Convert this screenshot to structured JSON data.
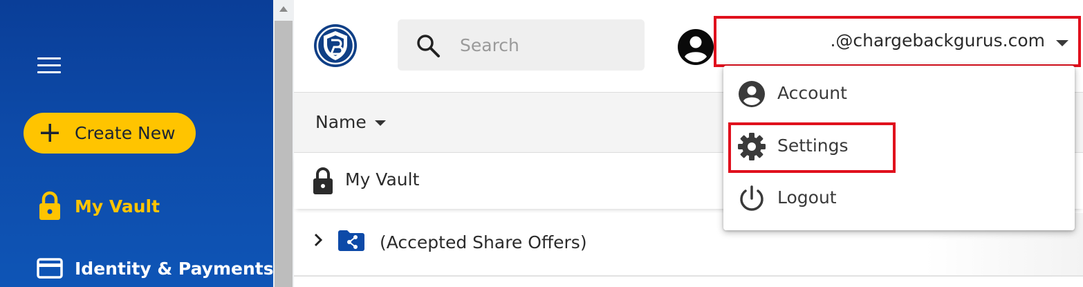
{
  "sidebar": {
    "menu_icon": "hamburger-icon",
    "create_button": {
      "label": "Create New",
      "icon": "plus-icon"
    },
    "items": [
      {
        "label": "My Vault",
        "icon": "lock-icon",
        "active": true
      },
      {
        "label": "Identity & Payments",
        "icon": "credit-card-icon",
        "active": false
      }
    ]
  },
  "header": {
    "logo_icon": "keeper-shield-logo",
    "search": {
      "placeholder": "Search",
      "value": ""
    },
    "user": {
      "email": ".@chargebackgurus.com",
      "avatar_icon": "account-circle-icon"
    }
  },
  "user_menu": {
    "items": [
      {
        "label": "Account",
        "icon": "account-circle-icon"
      },
      {
        "label": "Settings",
        "icon": "gear-icon"
      },
      {
        "label": "Logout",
        "icon": "power-icon"
      }
    ]
  },
  "table": {
    "sort_column": "Name",
    "rows": [
      {
        "label": "My Vault",
        "icon": "lock-icon"
      },
      {
        "label": "(Accepted Share Offers)",
        "icon": "shared-folder-icon"
      }
    ]
  },
  "colors": {
    "sidebar_blue": "#0d4aa8",
    "accent_yellow": "#ffc400",
    "highlight_red": "#e0101d",
    "text_dark": "#2b2b2b"
  }
}
